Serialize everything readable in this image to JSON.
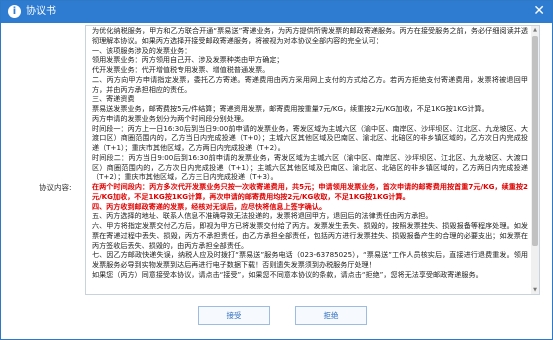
{
  "dialog": {
    "title": "协议书",
    "close_glyph": "✕",
    "info_glyph": "i",
    "label": "协议内容:"
  },
  "agreement": {
    "lines": [
      {
        "text": "为优化纳税服务，甲方和乙方联合开通“票易送”寄递业务，为丙方提供所需发票的邮政寄递服务。丙方在接受服务之前，务必仔细阅读并透彻理解本协议。如果丙方选择开接受邮政寄递服务，将被视为对本协议全部内容的完全认可：",
        "style": ""
      },
      {
        "text": "一、该项服务涉及的发票业务：",
        "style": ""
      },
      {
        "text": "领用发票业务：丙方领用自己开、涉及发票种类由甲方确定；",
        "style": ""
      },
      {
        "text": "代开发票业务：代开增值税专用发票、增值税普通发票。",
        "style": ""
      },
      {
        "text": "二、丙方向甲方申请指定发票，委托乙方寄递。寄递费用由丙方采用网上支付的方式给乙方。若丙方拒绝支付寄递费用，发票将被退回甲方，并由丙方承担相应的责任。",
        "style": ""
      },
      {
        "text": "三、寄递资费",
        "style": ""
      },
      {
        "text": "票易送发票业务，邮寄费按5元/件结算；寄递资用发票，邮寄费用按重量7元/KG，续重按2元/KG加收，不足1KG按1KG计算。",
        "style": ""
      },
      {
        "text": "丙方申请的发票业务划分为两个时间段分别处理。",
        "style": ""
      },
      {
        "text": "时间段一：丙方上一日16:30后到当日9:00前申请的发票业务，寄发区域为主城六区（渝中区、南岸区、沙坪坝区、江北区、九龙坡区、大渡口区）商圈范围内的，乙方当日内完成投递（T+0）；主城六区其他区域及巴南区、渝北区、北碚区的非乡镇区域的，乙方次日内完成投递（T+1）；重庆市其他区域，乙方两日内完成投递（T+2）。",
        "style": ""
      },
      {
        "text": "时间段二：丙方当日9:00后到16:30前申请的发票业务，寄发区域为主城六区（渝中区、南岸区、沙坪坝区、江北区、九龙坡区、大渡口区）商圈范围内的，乙方次日内完成投递（T+1）；主城六区其他区域及巴南区、渝北区、北碚区的非乡镇区域的，乙方两日内完成投递（T+2）；重庆市其他区域，乙方三日内完成投递（T+3）。",
        "style": ""
      },
      {
        "text": "在两个时间段内：丙方多次代开发票业务只按一次收寄递费用，共5元；申请领用发票业务，首次申请的邮寄费用按首重7元/KG，续重按2元/KG加收，不足1KG按1KG计算，再次申请的邮寄费用均按2元/KG收取，不足1KG按1KG计算。",
        "style": "red"
      },
      {
        "text": "四、丙方收到邮政寄递的发票，经核对无误后，应尽快将信息上签字确认。",
        "style": "red"
      },
      {
        "text": "五、丙方选择的地址、联系人信息不准确导致无法投递的，发票将退回甲方，退回后的法律责任由丙方承担。",
        "style": ""
      },
      {
        "text": "六、甲方将指定发票交付乙方后，即视为甲方已将发票交付给了丙方。发票发生丢失、损毁的，按照发票挂失、损毁报备等程序处理。如发票在寄递过程中丢失、损毁，丙方不承担责任，由乙方承担全部责任，包括丙方进行发票挂失、损毁报备产生的合理的必要支出；如发票在丙方签收后丢失、损毁的，由丙方承担全部责任。",
        "style": ""
      },
      {
        "text": "七、因乙方邮政快递失误，纳税人应及时拨打“票易送”服务电话（023-63785025），“票易送”工作人员核实后，直接进行退费重发。领用发票服务必导到实物发票到达后再进行电子数据下载！否则遗失发票须到办税服务厅处理！",
        "style": "mixed"
      },
      {
        "text": "如果您（丙方）同意接受本协议，请点击“接受”，如果您不同意本协议的条款，请点击“拒绝”，您将无法享受邮政寄递服务。",
        "style": ""
      }
    ]
  },
  "buttons": {
    "accept": "接受",
    "reject": "拒绝"
  },
  "colors": {
    "titlebar": "#2d7cd1",
    "emphasis": "#e00000"
  }
}
